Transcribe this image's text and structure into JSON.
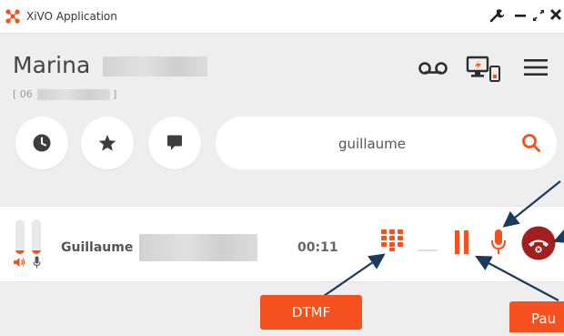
{
  "window": {
    "title": "XiVO Application"
  },
  "user": {
    "first_name": "Marina",
    "number_prefix": "[ 06",
    "number_suffix": "]"
  },
  "search": {
    "value": "guillaume"
  },
  "call": {
    "name": "Guillaume",
    "duration": "00:11",
    "speaker_level": 0.1,
    "mic_level": 0.1
  },
  "annotations": {
    "dtmf": "DTMF",
    "pause": "Pau"
  },
  "colors": {
    "accent": "#f4511e",
    "hangup": "#a31f1f",
    "dark_icon": "#3d3d3d",
    "arrow": "#1c3a5c"
  },
  "icons": [
    "xivo-logo-icon",
    "wrench-icon",
    "minimize-icon",
    "maximize-icon",
    "close-icon",
    "voicemail-icon",
    "devices-icon",
    "menu-icon",
    "history-icon",
    "favorites-star-icon",
    "chat-icon",
    "search-icon",
    "speaker-icon",
    "microphone-icon",
    "dialpad-icon",
    "pause-icon",
    "hangup-icon"
  ]
}
